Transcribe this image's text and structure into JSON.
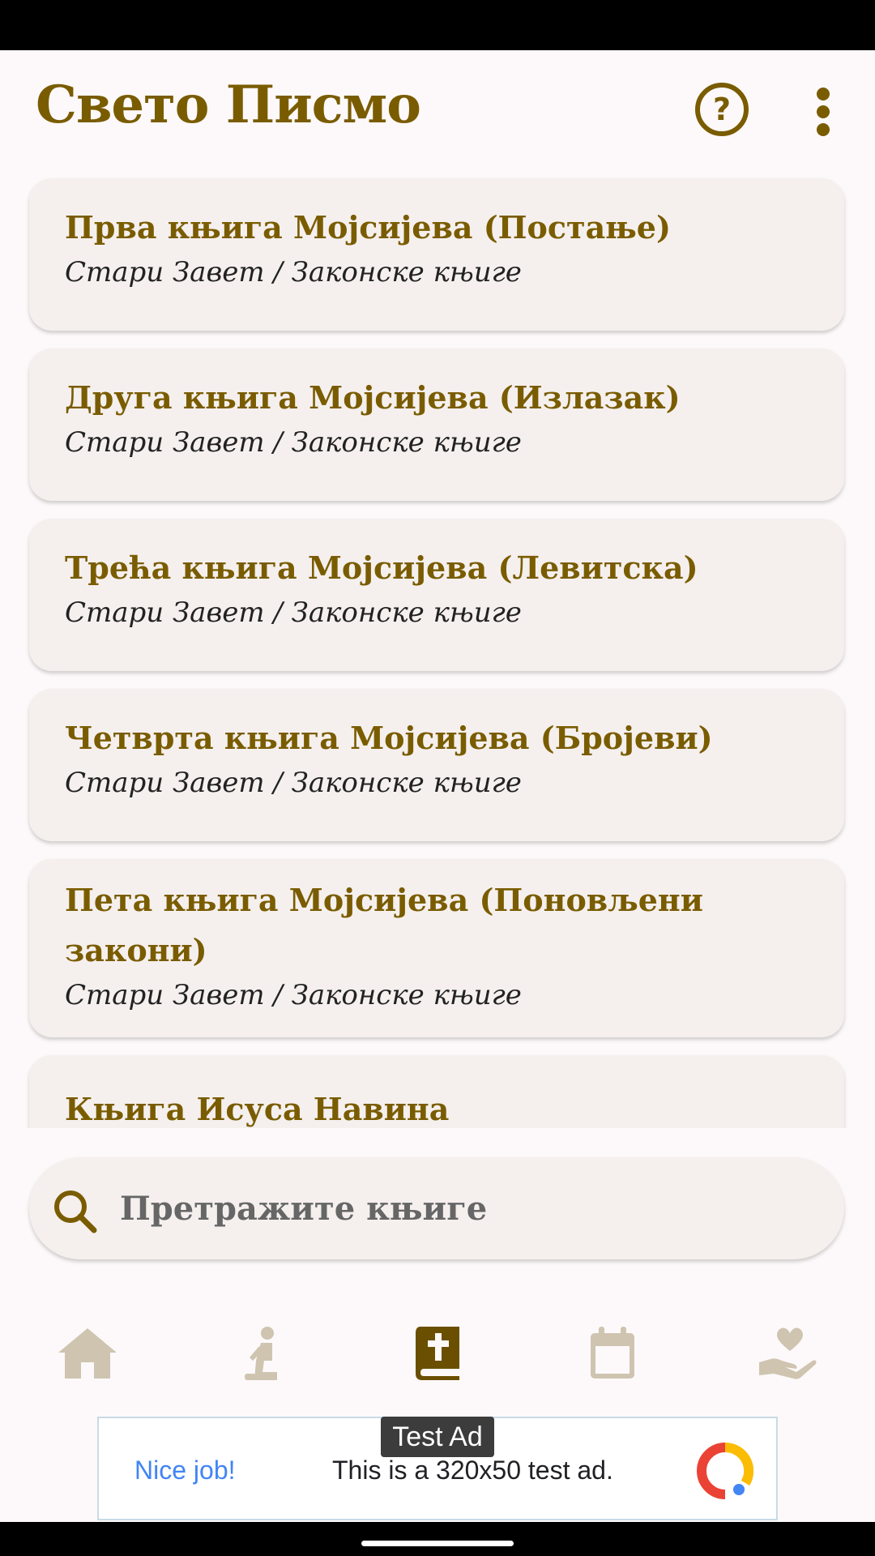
{
  "app_bar": {
    "title": "Свето Писмо",
    "help_icon": "help-circle-icon",
    "more_icon": "more-vertical-icon"
  },
  "books": [
    {
      "title": "Прва књига Мојсијева (Постање)",
      "subtitle": "Стари Завет / Законске књиге"
    },
    {
      "title": "Друга књига Мојсијева (Излазак)",
      "subtitle": "Стари Завет / Законске књиге"
    },
    {
      "title": "Трећа књига Мојсијева (Левитска)",
      "subtitle": "Стари Завет / Законске књиге"
    },
    {
      "title": "Четврта књига Мојсијева (Бројеви)",
      "subtitle": "Стари Завет / Законске књиге"
    },
    {
      "title": "Пета књига Мојсијева (Поновљени закони)",
      "subtitle": "Стари Завет / Законске књиге"
    },
    {
      "title": "Књига Исуса Навина",
      "subtitle": ""
    }
  ],
  "search": {
    "placeholder": "Претражите књиге",
    "icon": "search-icon"
  },
  "bottom_nav": {
    "items": [
      {
        "icon": "home-icon",
        "active": false
      },
      {
        "icon": "prayer-icon",
        "active": false
      },
      {
        "icon": "bible-icon",
        "active": true
      },
      {
        "icon": "calendar-icon",
        "active": false
      },
      {
        "icon": "charity-hand-heart-icon",
        "active": false
      }
    ],
    "active_color": "#6b4f00",
    "inactive_color": "#cfc4b0"
  },
  "ad": {
    "label": "Test Ad",
    "headline": "Nice job!",
    "text": "This is a 320x50 test ad.",
    "icon": "ad-logo-icon"
  },
  "colors": {
    "accent": "#7a5c00",
    "card_bg": "#f5f0ee",
    "page_bg": "#fdf9fa"
  }
}
